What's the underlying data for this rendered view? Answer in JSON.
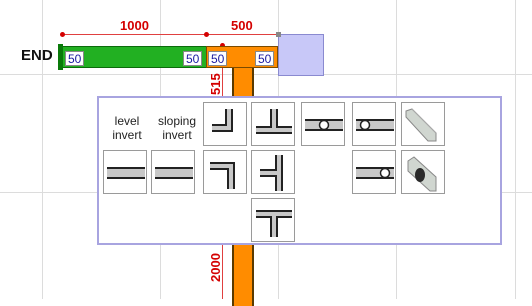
{
  "canvas": {
    "end_label": "END",
    "dimensions": {
      "top_left": "1000",
      "top_right": "500",
      "vertical_upper": "515",
      "vertical_lower": "2000"
    },
    "pipe_tags": [
      "50",
      "50",
      "50",
      "50"
    ]
  },
  "palette": {
    "labels": {
      "level_invert": "level\ninvert",
      "sloping_invert": "sloping\ninvert"
    },
    "tiles": [
      {
        "icon": "bend-down-left-icon"
      },
      {
        "icon": "tee-up-icon"
      },
      {
        "icon": "pipe-access-center-icon"
      },
      {
        "icon": "pipe-access-left-icon"
      },
      {
        "icon": "3d-pipe-end-icon"
      },
      {
        "icon": "level-invert-pipe-icon"
      },
      {
        "icon": "sloping-invert-pipe-icon"
      },
      {
        "icon": "bend-right-down-icon"
      },
      {
        "icon": "tee-left-icon"
      },
      {
        "icon": "pipe-access-right-icon"
      },
      {
        "icon": "3d-pipe-socket-icon"
      },
      {
        "icon": "tee-down-icon"
      }
    ]
  },
  "colors": {
    "dimension": "#d40000",
    "pipe_green": "#22b022",
    "pipe_orange": "#ff8c00",
    "node": "#c8c8f8",
    "palette_border": "#a8a4e0"
  }
}
